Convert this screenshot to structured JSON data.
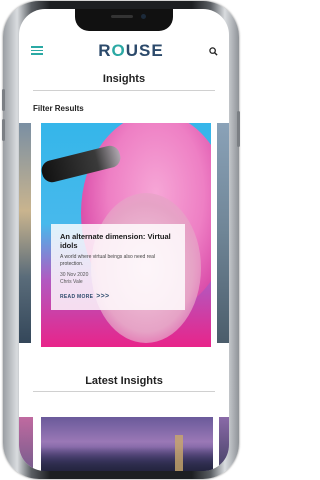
{
  "header": {
    "logo_prefix": "R",
    "logo_o": "O",
    "logo_suffix": "USE"
  },
  "page": {
    "title": "Insights",
    "filter_label": "Filter Results"
  },
  "featured_card": {
    "title": "An alternate dimension: Virtual idols",
    "description": "A world where virtual beings also need real protection.",
    "date": "30 Nov 2020",
    "author": "Chris Vale",
    "link_label": "READ MORE",
    "link_arrows": ">>>"
  },
  "latest": {
    "title": "Latest Insights"
  },
  "colors": {
    "brand_navy": "#2c4a6b",
    "brand_teal": "#2ba9a4"
  },
  "icons": [
    "hamburger-menu-icon",
    "search-icon"
  ]
}
